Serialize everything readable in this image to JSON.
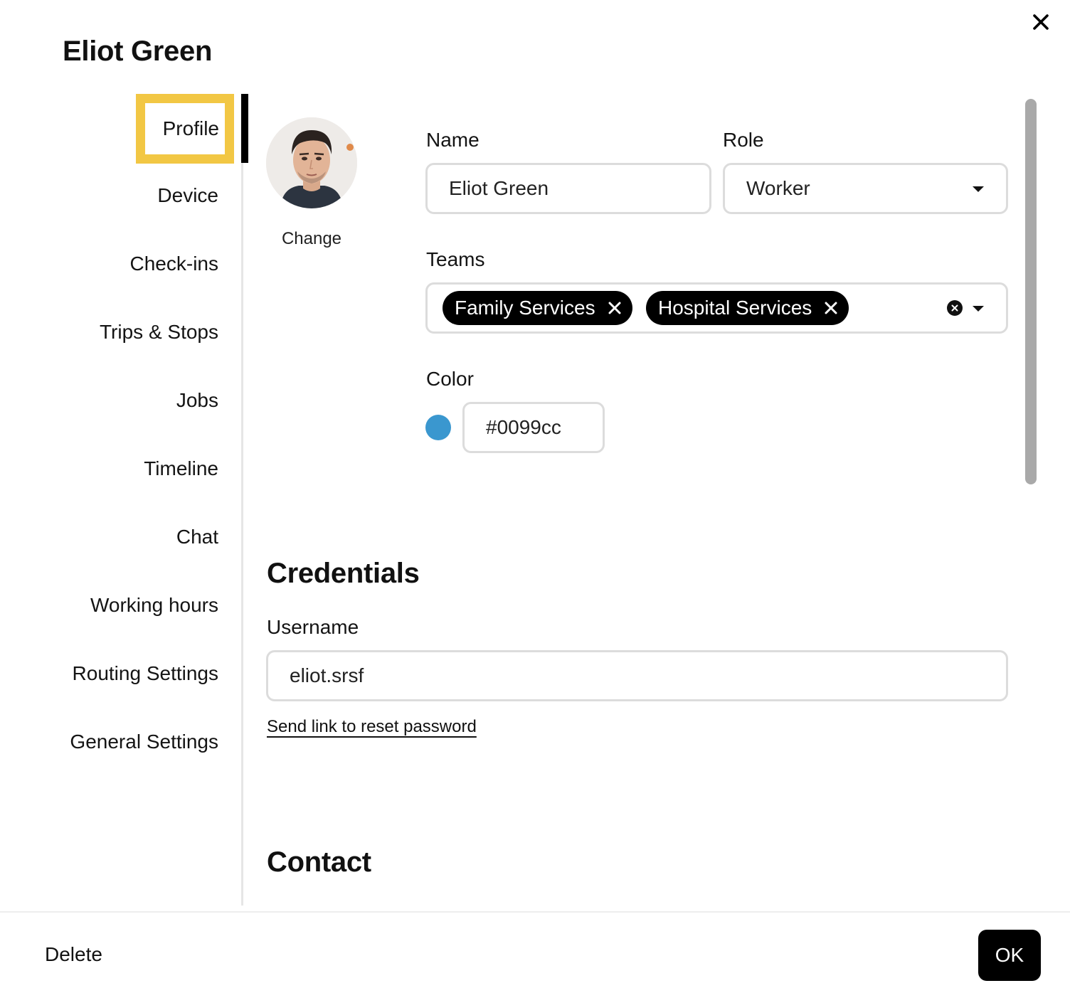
{
  "dialog": {
    "title": "Eliot Green",
    "close_icon": "close-icon"
  },
  "sidebar": {
    "items": [
      {
        "label": "Profile",
        "active": true
      },
      {
        "label": "Device"
      },
      {
        "label": "Check-ins"
      },
      {
        "label": "Trips & Stops"
      },
      {
        "label": "Jobs"
      },
      {
        "label": "Timeline"
      },
      {
        "label": "Chat"
      },
      {
        "label": "Working hours"
      },
      {
        "label": "Routing Settings"
      },
      {
        "label": "General Settings"
      }
    ],
    "active_highlight_color": "#f2c744"
  },
  "profile": {
    "avatar_icon": "avatar-photo",
    "change_label": "Change",
    "name_label": "Name",
    "name_value": "Eliot Green",
    "role_label": "Role",
    "role_value": "Worker",
    "teams_label": "Teams",
    "teams": [
      "Family Services",
      "Hospital Services"
    ],
    "color_label": "Color",
    "color_value": "#0099cc",
    "swatch_color": "#3a97cf"
  },
  "credentials": {
    "title": "Credentials",
    "username_label": "Username",
    "username_value": "eliot.srsf",
    "reset_link": "Send link to reset password"
  },
  "contact": {
    "title": "Contact"
  },
  "footer": {
    "delete_label": "Delete",
    "ok_label": "OK"
  }
}
